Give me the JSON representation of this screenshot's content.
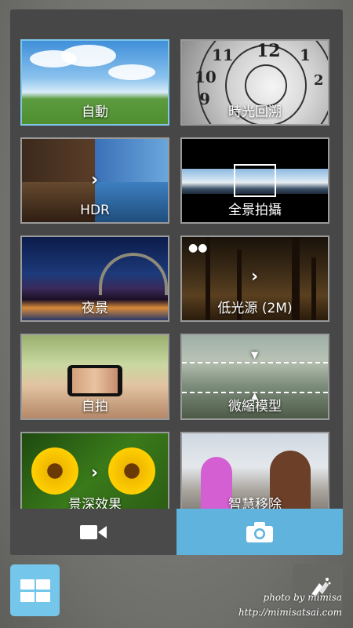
{
  "modes": {
    "auto": {
      "label": "自動",
      "selected": true
    },
    "time_rewind": {
      "label": "時光回溯"
    },
    "hdr": {
      "label": "HDR"
    },
    "panorama": {
      "label": "全景拍攝"
    },
    "night": {
      "label": "夜景"
    },
    "low_light": {
      "label": "低光源 (2M)"
    },
    "selfie": {
      "label": "自拍"
    },
    "miniature": {
      "label": "微縮模型"
    },
    "depth_of_field": {
      "label": "景深效果"
    },
    "smart_remove": {
      "label": "智慧移除"
    }
  },
  "clock_numbers": [
    "11",
    "12",
    "1",
    "10",
    "2",
    "9"
  ],
  "bottom_bar": {
    "video_icon": "video-camera-icon",
    "photo_icon": "camera-icon",
    "active": "photo"
  },
  "grid_button_icon": "grid-icon",
  "effect_button_icon": "effects-icon",
  "watermark": {
    "line1": "photo by mimisa",
    "line2": "http://mimisatsai.com"
  },
  "colors": {
    "accent": "#5fb3dc",
    "grid_button": "#74c7ea",
    "panel": "#474747",
    "selected_border": "#7fc6e8"
  }
}
